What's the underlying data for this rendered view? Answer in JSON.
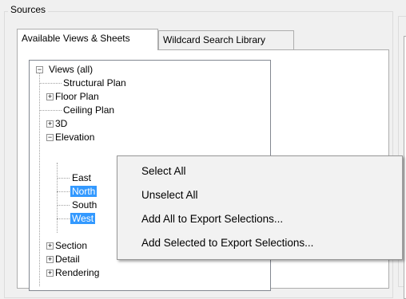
{
  "group": {
    "title": "Sources"
  },
  "tabs": [
    {
      "label": "Available Views & Sheets",
      "active": true
    },
    {
      "label": "Wildcard Search Library",
      "active": false
    }
  ],
  "tree": {
    "root": {
      "label": "Views (all)",
      "expander": "−"
    },
    "items": [
      {
        "label": "Structural Plan"
      },
      {
        "label": "Floor Plan",
        "expander": "+"
      },
      {
        "label": "Ceiling Plan"
      },
      {
        "label": "3D",
        "expander": "+"
      },
      {
        "label": "Elevation",
        "expander": "−"
      },
      {
        "label": "East"
      },
      {
        "label": "North",
        "selected": true
      },
      {
        "label": "South"
      },
      {
        "label": "West",
        "selected": true
      },
      {
        "label": "Section",
        "expander": "+"
      },
      {
        "label": "Detail",
        "expander": "+"
      },
      {
        "label": "Rendering",
        "expander": "+"
      }
    ]
  },
  "context_menu": {
    "items": [
      "Select All",
      "Unselect All",
      "Add All to Export Selections...",
      "Add Selected to Export Selections..."
    ]
  },
  "colors": {
    "selection": "#3399ff",
    "menu_bg": "#f2f2f2"
  }
}
